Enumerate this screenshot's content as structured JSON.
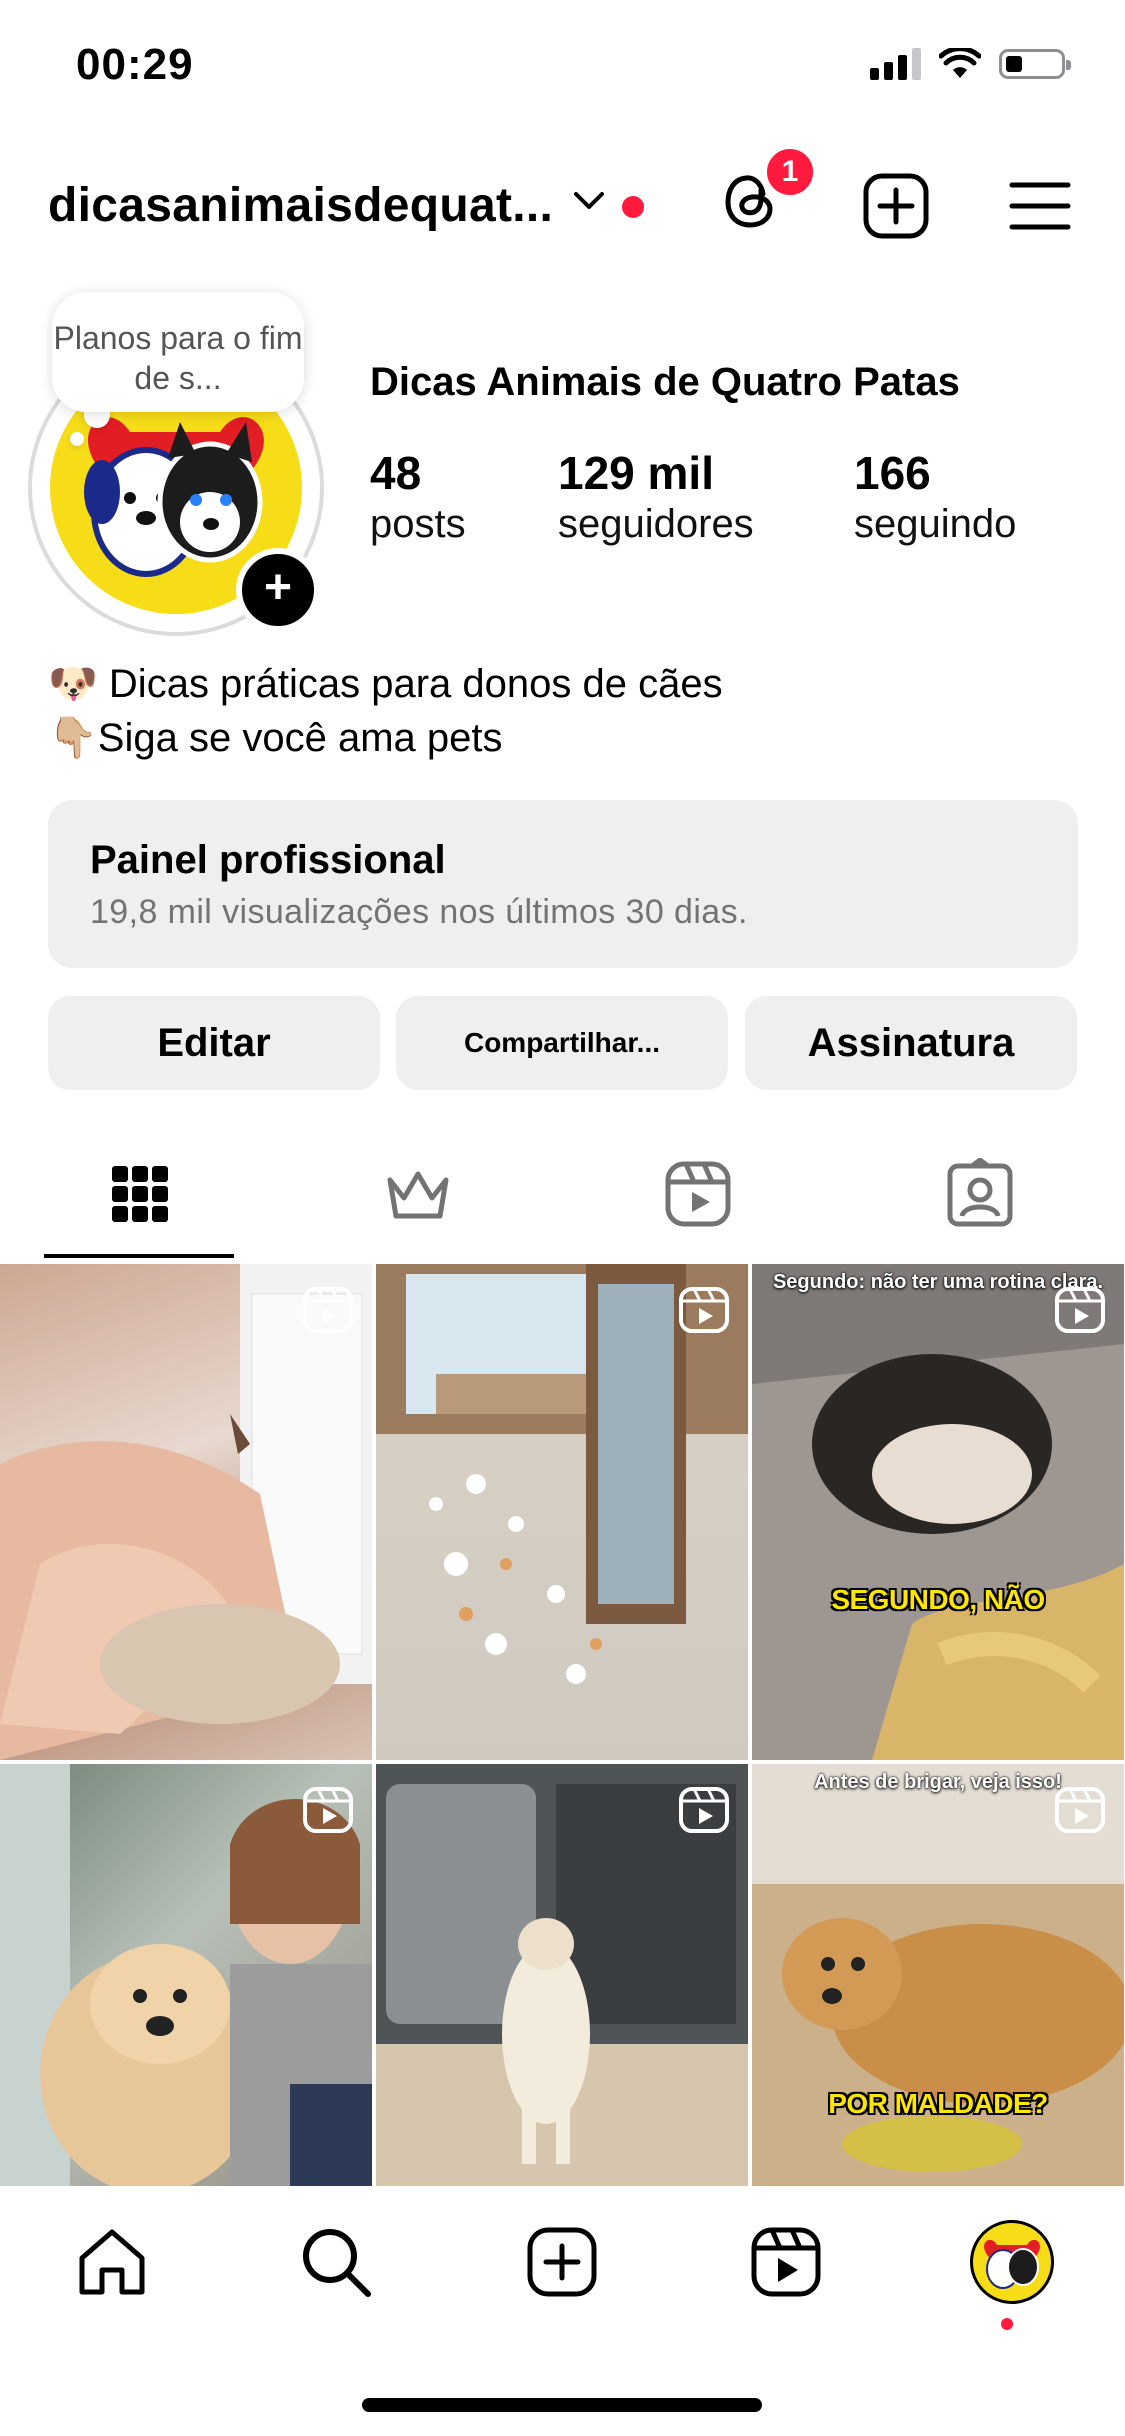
{
  "status_bar": {
    "time": "00:29"
  },
  "header": {
    "username": "dicasanimaisdequat...",
    "threads_badge": "1"
  },
  "profile": {
    "note": "Planos para o fim de s...",
    "display_name": "Dicas Animais de Quatro Patas",
    "stats": [
      {
        "value": "48",
        "label": "posts"
      },
      {
        "value": "129 mil",
        "label": "seguidores"
      },
      {
        "value": "166",
        "label": "seguindo"
      }
    ],
    "bio_lines": [
      "🐶 Dicas práticas para donos de cães",
      "👇🏼Siga se você ama pets"
    ]
  },
  "dashboard": {
    "title": "Painel profissional",
    "subtitle": "19,8 mil visualizações nos últimos 30 dias."
  },
  "buttons": {
    "edit": "Editar",
    "share": "Compartilhar...",
    "subscription": "Assinatura"
  },
  "tabs": [
    "grid-icon",
    "crown-icon",
    "reels-icon",
    "tagged-icon"
  ],
  "grid": {
    "captions": {
      "post3_top": "Segundo: não ter uma rotina clara.",
      "post3_mid": "SEGUNDO, NÃO",
      "post6_top": "Antes de brigar, veja isso!",
      "post6_mid": "POR MALDADE?"
    }
  },
  "bottom_nav": [
    "home-icon",
    "search-icon",
    "create-icon",
    "reels-icon",
    "profile-avatar"
  ],
  "colors": {
    "accent_red": "#ff1a3e",
    "button_bg": "#efefef",
    "avatar_yellow": "#f6dd18"
  }
}
